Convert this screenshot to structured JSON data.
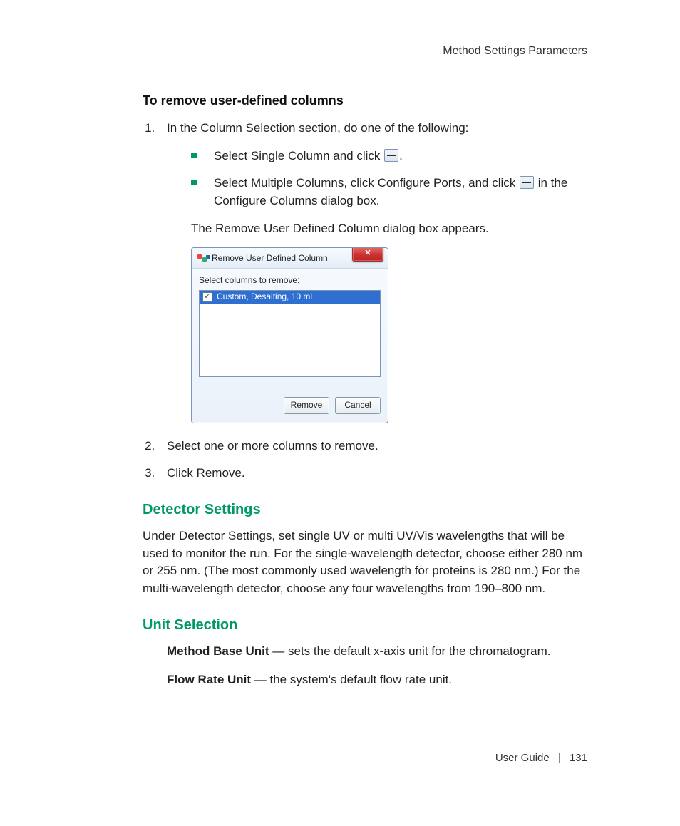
{
  "header": {
    "right": "Method Settings Parameters"
  },
  "section1": {
    "heading": "To remove user-defined columns",
    "step1_intro": "In the Column Selection section, do one of the following:",
    "bullet1_pre": "Select Single Column and click ",
    "bullet1_post": ".",
    "bullet2_pre": "Select Multiple Columns, click Configure Ports, and click ",
    "bullet2_post": " in the Configure Columns dialog box.",
    "after_bullets": "The Remove User Defined Column dialog box appears.",
    "step2": "Select one or more columns to remove.",
    "step3": "Click Remove."
  },
  "dialog": {
    "title": "Remove User Defined Column",
    "label": "Select columns to remove:",
    "item": "Custom, Desalting, 10 ml",
    "remove": "Remove",
    "cancel": "Cancel",
    "close_x": "✕"
  },
  "detector": {
    "heading": "Detector Settings",
    "para": "Under Detector Settings, set single UV or multi UV/Vis wavelengths that will be used to monitor the run. For the single-wavelength detector, choose either 280 nm or 255 nm. (The most commonly used wavelength for proteins is 280 nm.) For the multi-wavelength detector, choose any four wavelengths from 190–800 nm."
  },
  "unit": {
    "heading": "Unit Selection",
    "mb_label": "Method Base Unit",
    "mb_text": " — sets the default x-axis unit for the chromatogram.",
    "fr_label": "Flow Rate Unit",
    "fr_text": " — the system's default flow rate unit."
  },
  "footer": {
    "guide": "User Guide",
    "sep": "|",
    "page": "131"
  }
}
